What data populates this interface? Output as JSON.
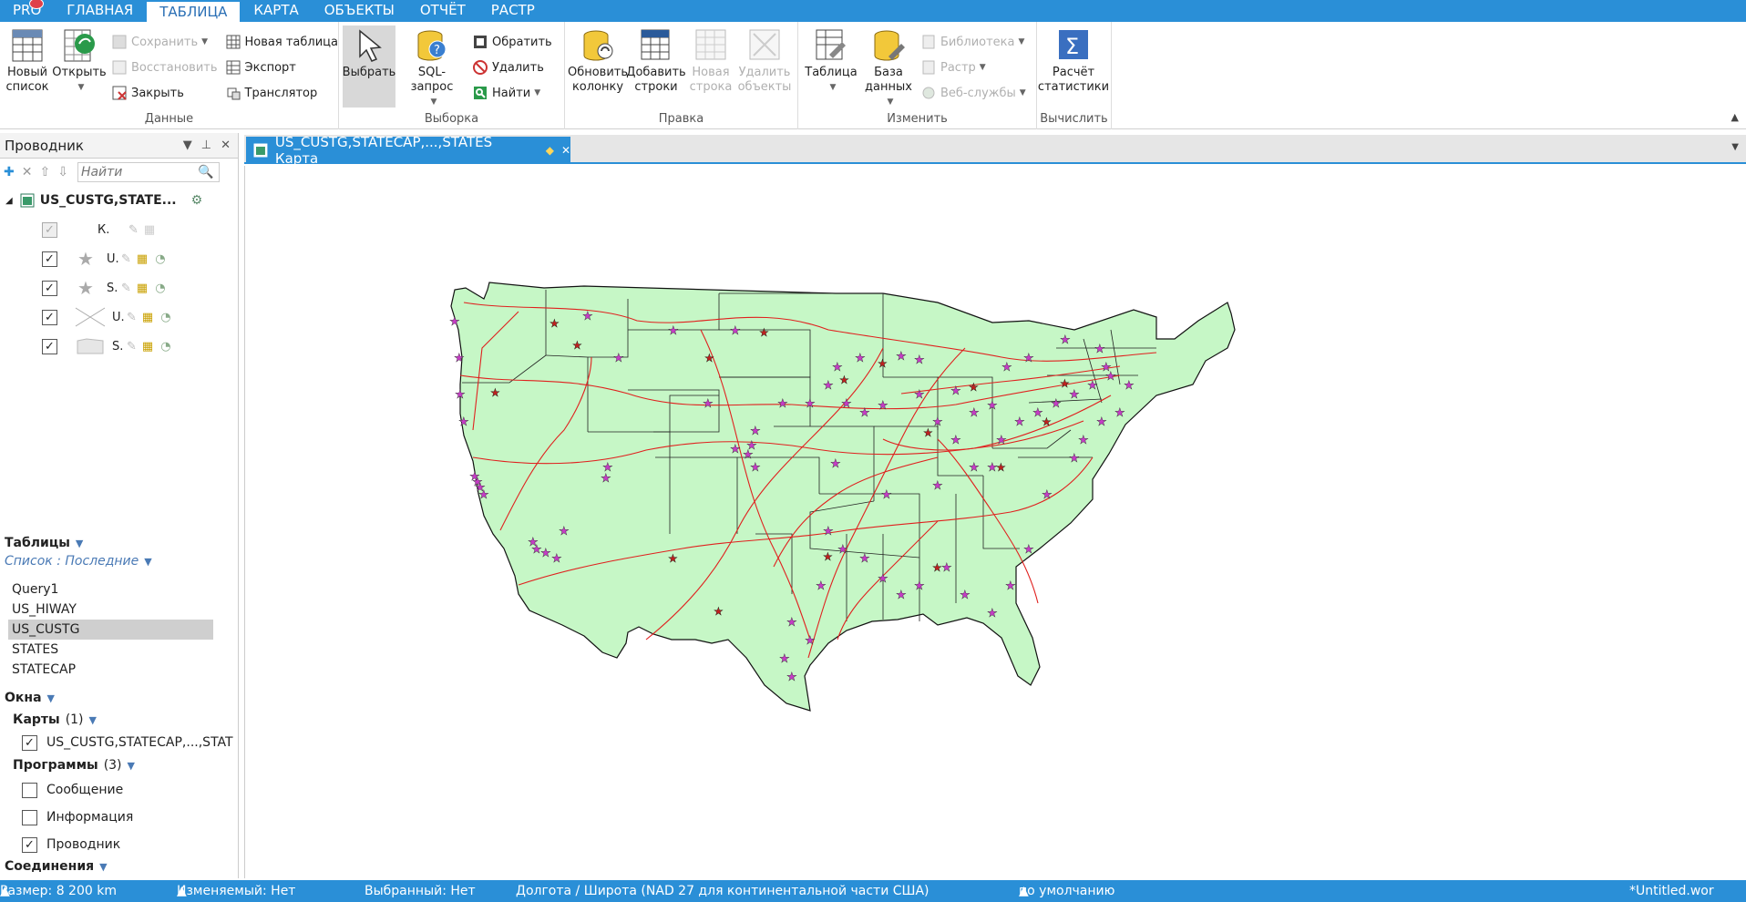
{
  "menu": {
    "pro": "PRO",
    "tabs": [
      "ГЛАВНАЯ",
      "ТАБЛИЦА",
      "КАРТА",
      "ОБЪЕКТЫ",
      "ОТЧЁТ",
      "РАСТР"
    ],
    "active_tab": "ТАБЛИЦА"
  },
  "ribbon": {
    "data_group": {
      "label": "Данные",
      "new_list": "Новый список",
      "open": "Открыть",
      "save": "Сохранить",
      "restore": "Восстановить",
      "close": "Закрыть",
      "new_table": "Новая таблица",
      "export": "Экспорт",
      "translator": "Транслятор"
    },
    "select_group": {
      "label": "Выборка",
      "select": "Выбрать",
      "sql": "SQL-запрос",
      "invert": "Обратить",
      "delete": "Удалить",
      "find": "Найти"
    },
    "edit_group": {
      "label": "Правка",
      "update_col": "Обновить колонку",
      "add_rows": "Добавить строки",
      "new_row": "Новая строка",
      "delete_objects": "Удалить объекты"
    },
    "change_group": {
      "label": "Изменить",
      "table": "Таблица",
      "database": "База данных",
      "library": "Библиотека",
      "raster": "Растр",
      "webservices": "Веб-службы"
    },
    "calc_group": {
      "label": "Вычислить",
      "stats": "Расчёт статистики"
    }
  },
  "explorer": {
    "title": "Проводник",
    "search_placeholder": "Найти",
    "root": "US_CUSTG,STATE...",
    "layers": [
      {
        "letter": "К.",
        "checked": true,
        "gray": true
      },
      {
        "letter": "U.",
        "checked": true
      },
      {
        "letter": "S.",
        "checked": true
      },
      {
        "letter": "U.",
        "checked": true
      },
      {
        "letter": "S.",
        "checked": true
      }
    ],
    "tables_title": "Таблицы",
    "tables_list_label": "Список : Последние",
    "tables": [
      "Query1",
      "US_HIWAY",
      "US_CUSTG",
      "STATES",
      "STATECAP"
    ],
    "selected_table": "US_CUSTG",
    "windows_title": "Окна",
    "maps_label": "Карты",
    "maps_count": "(1)",
    "map_window": "US_CUSTG,STATECAP,...,STAT",
    "programs_label": "Программы",
    "programs_count": "(3)",
    "programs": [
      {
        "name": "Сообщение",
        "checked": false
      },
      {
        "name": "Информация",
        "checked": false
      },
      {
        "name": "Проводник",
        "checked": true
      }
    ],
    "connections_label": "Соединения"
  },
  "document_tab": {
    "title": "US_CUSTG,STATECAP,...,STATES Карта"
  },
  "map": {
    "land_color": "#c6f7c6",
    "road_color": "#e0201e",
    "point_color": "#c63cc6",
    "capital_color": "#c0201e"
  },
  "status": {
    "size": "Размер: 8 200 km",
    "editable": "Изменяемый: Нет",
    "selected": "Выбранный: Нет",
    "projection": "Долгота / Широта (NAD 27 для континентальной части США)",
    "default": "по умолчанию",
    "workspace": "*Untitled.wor"
  }
}
